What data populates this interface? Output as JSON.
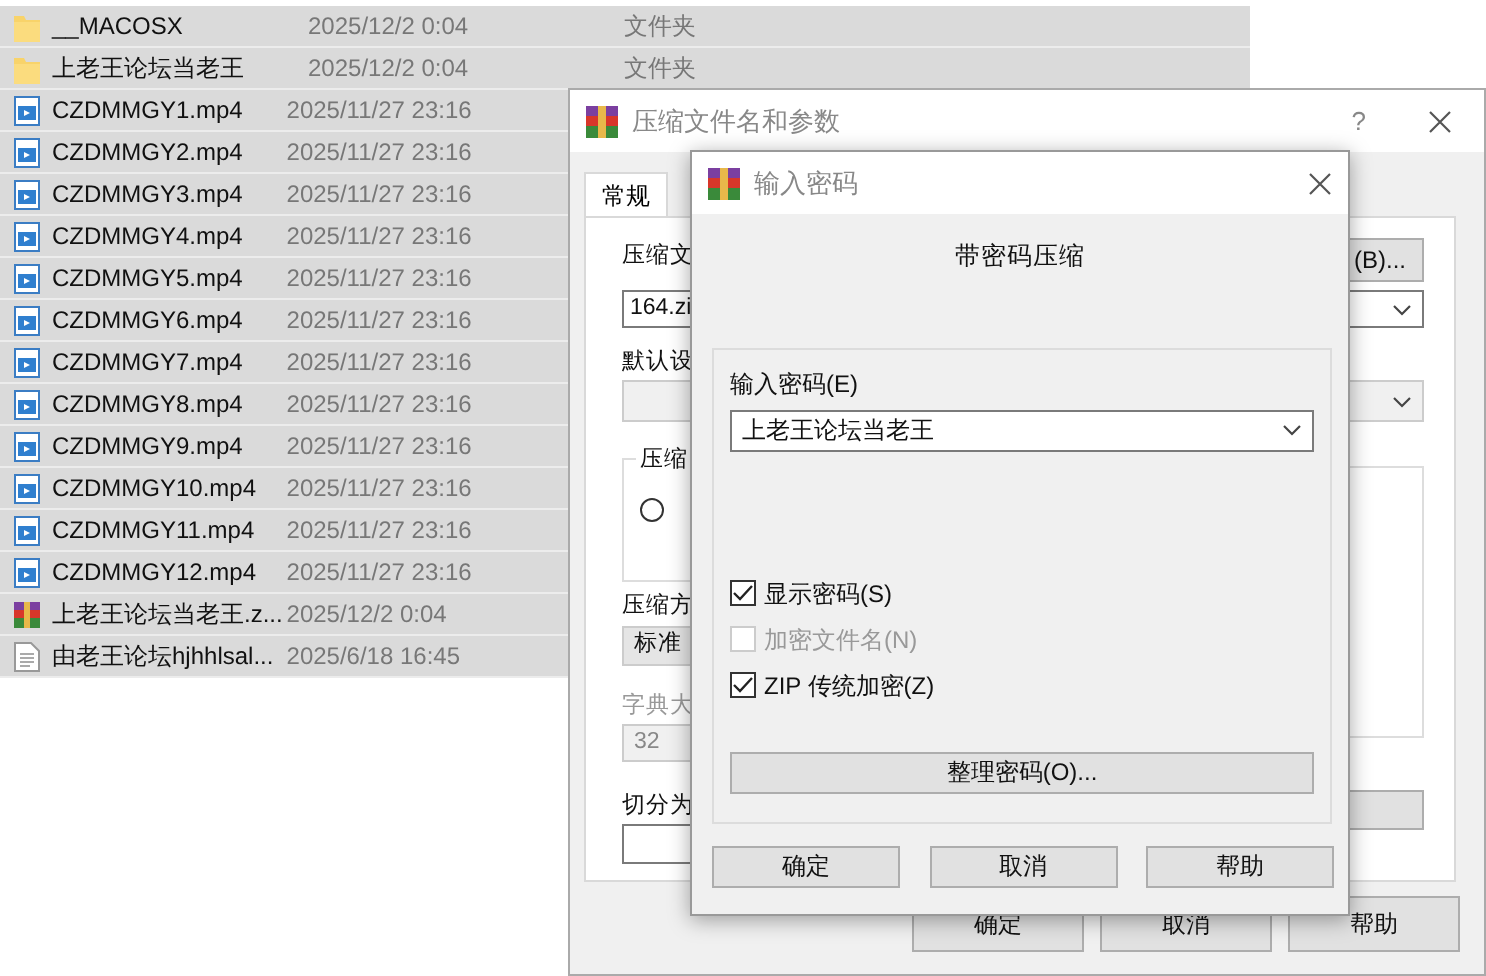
{
  "files": [
    {
      "kind": "folder",
      "name": "__MACOSX",
      "date": "2025/12/2 0:04",
      "type": "文件夹"
    },
    {
      "kind": "folder",
      "name": "上老王论坛当老王",
      "date": "2025/12/2 0:04",
      "type": "文件夹"
    },
    {
      "kind": "video",
      "name": "CZDMMGY1.mp4",
      "date": "2025/11/27 23:16"
    },
    {
      "kind": "video",
      "name": "CZDMMGY2.mp4",
      "date": "2025/11/27 23:16"
    },
    {
      "kind": "video",
      "name": "CZDMMGY3.mp4",
      "date": "2025/11/27 23:16"
    },
    {
      "kind": "video",
      "name": "CZDMMGY4.mp4",
      "date": "2025/11/27 23:16"
    },
    {
      "kind": "video",
      "name": "CZDMMGY5.mp4",
      "date": "2025/11/27 23:16"
    },
    {
      "kind": "video",
      "name": "CZDMMGY6.mp4",
      "date": "2025/11/27 23:16"
    },
    {
      "kind": "video",
      "name": "CZDMMGY7.mp4",
      "date": "2025/11/27 23:16"
    },
    {
      "kind": "video",
      "name": "CZDMMGY8.mp4",
      "date": "2025/11/27 23:16"
    },
    {
      "kind": "video",
      "name": "CZDMMGY9.mp4",
      "date": "2025/11/27 23:16"
    },
    {
      "kind": "video",
      "name": "CZDMMGY10.mp4",
      "date": "2025/11/27 23:16"
    },
    {
      "kind": "video",
      "name": "CZDMMGY11.mp4",
      "date": "2025/11/27 23:16"
    },
    {
      "kind": "video",
      "name": "CZDMMGY12.mp4",
      "date": "2025/11/27 23:16"
    },
    {
      "kind": "archive",
      "name": "上老王论坛当老王.z...",
      "date": "2025/12/2 0:04"
    },
    {
      "kind": "text",
      "name": "由老王论坛hjhhlsal...",
      "date": "2025/6/18 16:45"
    }
  ],
  "archive_dialog": {
    "title": "压缩文件名和参数",
    "help": "?",
    "tabs": [
      {
        "label": "常规",
        "selected": true
      }
    ],
    "archive_name_label": "压缩文",
    "browse_button": "(B)...",
    "archive_name": "164.zi",
    "profiles_label": "默认设",
    "format_group_label": "压缩",
    "format_radio": {
      "selected": false
    },
    "method_label": "压缩方",
    "method": "标准",
    "dictionary_label": "字典大",
    "dictionary": "32",
    "split_label": "切分为",
    "buttons": [
      "确定",
      "取消",
      "帮助"
    ]
  },
  "password_dialog": {
    "title": "输入密码",
    "heading": "带密码压缩",
    "password_label": "输入密码(E)",
    "password": "上老王论坛当老王",
    "options": [
      {
        "label": "显示密码(S)",
        "checked": true,
        "disabled": false
      },
      {
        "label": "加密文件名(N)",
        "checked": false,
        "disabled": true
      },
      {
        "label": "ZIP 传统加密(Z)",
        "checked": true,
        "disabled": false
      }
    ],
    "organize_button": "整理密码(O)...",
    "buttons": [
      "确定",
      "取消",
      "帮助"
    ]
  }
}
